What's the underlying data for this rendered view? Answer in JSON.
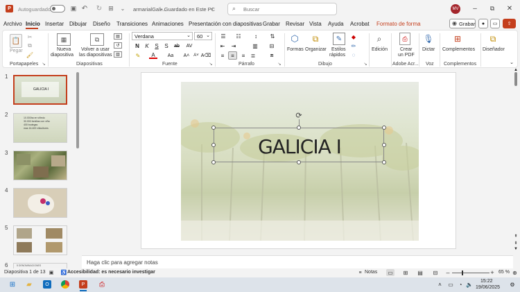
{
  "titlebar": {
    "autosave_label": "Autoguardado",
    "file_name": "armarialGali...",
    "save_status": "• Guardado en Este PC",
    "search_placeholder": "Buscar",
    "user_initials": "MV"
  },
  "menu": {
    "items": [
      "Archivo",
      "Inicio",
      "Insertar",
      "Dibujar",
      "Diseño",
      "Transiciones",
      "Animaciones",
      "Presentación con diapositivas",
      "Grabar",
      "Revisar",
      "Vista",
      "Ayuda",
      "Acrobat",
      "Formato de forma"
    ],
    "active": "Inicio",
    "record_button": "Grabar"
  },
  "ribbon": {
    "paste": "Pegar",
    "new_slide_1": "Nueva",
    "new_slide_2": "diapositiva",
    "reuse_1": "Volver a usar",
    "reuse_2": "las diapositivas",
    "font_name": "Verdana",
    "font_size": "60",
    "shapes": "Formas",
    "arrange": "Organizar",
    "styles_1": "Estilos",
    "styles_2": "rápidos",
    "edit": "Edición",
    "pdf_1": "Crear",
    "pdf_2": "un PDF",
    "dictate": "Dictar",
    "addins": "Complementos",
    "designer": "Diseñador",
    "groups": {
      "clipboard": "Portapapeles",
      "slides": "Diapositivas",
      "font": "Fuente",
      "paragraph": "Párrafo",
      "drawing": "Dibujo",
      "acrobat": "Adobe Acr...",
      "voice": "Voz",
      "addins": "Complementos"
    }
  },
  "thumbnails": [
    {
      "num": "1",
      "text": "GALICIA I"
    },
    {
      "num": "2",
      "text": "10.000ha en viñedo\n30.000 familias con viña\n400 bodegas\nmas 16.400 viticultores"
    },
    {
      "num": "3",
      "text": ""
    },
    {
      "num": "4",
      "text": ""
    },
    {
      "num": "5",
      "text": ""
    },
    {
      "num": "6",
      "text": "5 DENOMINACIONES"
    }
  ],
  "slide": {
    "title": "GALICIA I"
  },
  "notes_placeholder": "Haga clic para agregar notas",
  "status": {
    "slide_info": "Diapositiva 1 de 13",
    "accessibility": "Accesibilidad: es necesario investigar",
    "notes": "Notas",
    "zoom": "65 %"
  },
  "taskbar": {
    "time": "15:22",
    "date": "19/06/2025"
  },
  "colors": {
    "accent": "#c43e1c",
    "background": "#f3f3f3"
  }
}
